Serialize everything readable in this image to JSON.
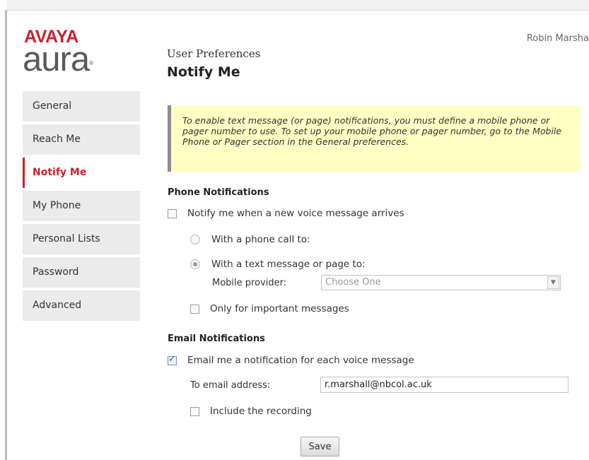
{
  "logo": {
    "brand": "AVAYA",
    "product": "aura",
    "trademark": "®"
  },
  "header": {
    "user_name": "Robin Marsha",
    "breadcrumb": "User Preferences",
    "title": "Notify Me"
  },
  "sidebar": {
    "items": [
      {
        "label": "General",
        "active": false
      },
      {
        "label": "Reach Me",
        "active": false
      },
      {
        "label": "Notify Me",
        "active": true
      },
      {
        "label": "My Phone",
        "active": false
      },
      {
        "label": "Personal Lists",
        "active": false
      },
      {
        "label": "Password",
        "active": false
      },
      {
        "label": "Advanced",
        "active": false
      }
    ]
  },
  "info": {
    "text": "To enable text message (or page) notifications, you must define a mobile phone or pager number to use. To set up your mobile phone or pager number, go to the Mobile Phone or Pager section in the General preferences."
  },
  "phone_notifications": {
    "title": "Phone Notifications",
    "notify_label": "Notify me when a new voice message arrives",
    "notify_checked": false,
    "phone_call_label": "With a phone call to:",
    "text_message_label": "With a text message or page to:",
    "selected_method": "text_message",
    "mobile_provider_label": "Mobile provider:",
    "mobile_provider_value": "Choose One",
    "important_only_label": "Only for important messages",
    "important_only_checked": false
  },
  "email_notifications": {
    "title": "Email Notifications",
    "email_label": "Email me a notification for each voice message",
    "email_checked": true,
    "address_label": "To email address:",
    "address_value": "r.marshall@nbcol.ac.uk",
    "include_recording_label": "Include the recording",
    "include_recording_checked": false
  },
  "actions": {
    "save_label": "Save"
  },
  "colors": {
    "accent": "#cc1f2e",
    "info_bg": "#ffffc4",
    "sidebar_bg": "#ebebeb"
  }
}
